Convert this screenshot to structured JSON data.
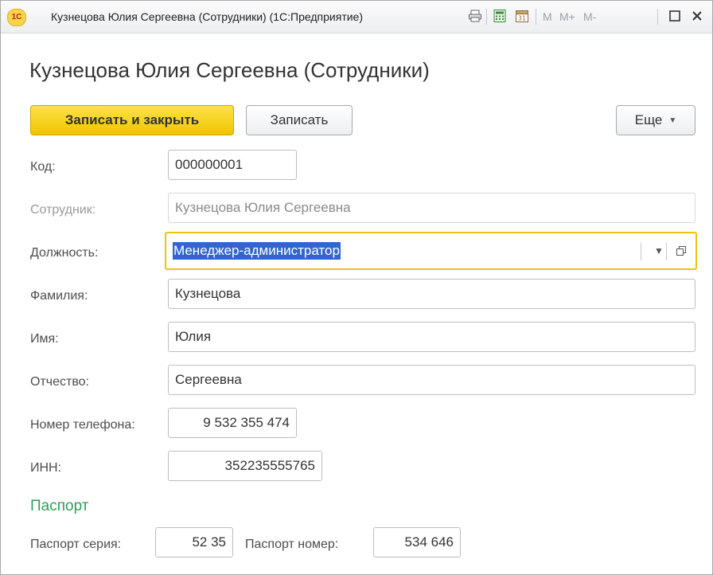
{
  "window": {
    "logo_text": "1С",
    "title": "Кузнецова Юлия Сергеевна (Сотрудники)  (1С:Предприятие)",
    "calendar_day": "31",
    "memory_buttons": [
      "M",
      "M+",
      "M-"
    ]
  },
  "form": {
    "title": "Кузнецова Юлия Сергеевна (Сотрудники)"
  },
  "toolbar": {
    "save_close_label": "Записать и закрыть",
    "save_label": "Записать",
    "more_label": "Еще"
  },
  "fields": {
    "code": {
      "label": "Код:",
      "value": "000000001"
    },
    "employee": {
      "label": "Сотрудник:",
      "value": "Кузнецова Юлия Сергеевна"
    },
    "position": {
      "label": "Должность:",
      "value": "Менеджер-администратор"
    },
    "last_name": {
      "label": "Фамилия:",
      "value": "Кузнецова"
    },
    "first_name": {
      "label": "Имя:",
      "value": "Юлия"
    },
    "patronymic": {
      "label": "Отчество:",
      "value": "Сергеевна"
    },
    "phone": {
      "label": "Номер телефона:",
      "value": "9 532 355 474"
    },
    "inn": {
      "label": "ИНН:",
      "value": "352235555765"
    }
  },
  "passport": {
    "section_title": "Паспорт",
    "series": {
      "label": "Паспорт серия:",
      "value": "52 35"
    },
    "number": {
      "label": "Паспорт номер:",
      "value": "534 646"
    }
  },
  "colors": {
    "primary_button": "#f2c400",
    "focus_border": "#f0c20a",
    "section_title": "#2f9e59",
    "selection": "#3366cc"
  }
}
